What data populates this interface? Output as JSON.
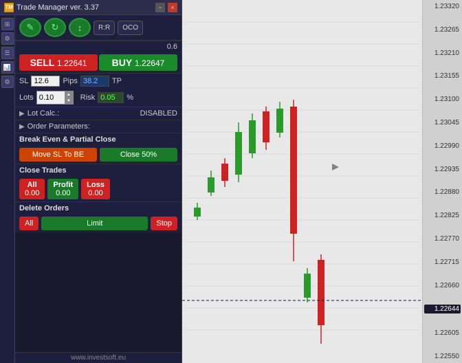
{
  "titleBar": {
    "title": "Trade Manager ver. 3.37",
    "minLabel": "−",
    "closeLabel": "×",
    "icon": "TM"
  },
  "toolbar": {
    "btn1": "✎",
    "btn2": "↻",
    "btn3": "↕",
    "rrLabel": "R:R",
    "ocoLabel": "OCO"
  },
  "lotDisplay": {
    "value": "0.6"
  },
  "tradeButtons": {
    "sellLabel": "SELL",
    "sellPrice": "1.22641",
    "buyLabel": "BUY",
    "buyPrice": "1.22647"
  },
  "slTp": {
    "slLabel": "SL",
    "slValue": "12.6",
    "pipsLabel": "Pips",
    "tpValue": "38.2",
    "tpLabel": "TP"
  },
  "lots": {
    "label": "Lots",
    "value": "0.10",
    "riskLabel": "Risk",
    "riskValue": "0.05",
    "percentLabel": "%"
  },
  "lotCalc": {
    "label": "Lot Calc.:",
    "value": "DISABLED"
  },
  "orderParams": {
    "label": "Order Parameters:"
  },
  "breakEven": {
    "title": "Break Even & Partial Close",
    "moveSlBtn": "Move SL To BE",
    "close50Btn": "Close 50%"
  },
  "closeTrades": {
    "title": "Close Trades",
    "allLabel": "All",
    "allValue": "0.00",
    "profitLabel": "Profit",
    "profitValue": "0.00",
    "lossLabel": "Loss",
    "lossValue": "0.00"
  },
  "deleteOrders": {
    "title": "Delete Orders",
    "allLabel": "All",
    "limitLabel": "Limit",
    "stopLabel": "Stop"
  },
  "footer": {
    "url": "www.investsoft.eu"
  },
  "priceScale": {
    "prices": [
      "1.23320",
      "1.23265",
      "1.23210",
      "1.23155",
      "1.23100",
      "1.23045",
      "1.22990",
      "1.22935",
      "1.22880",
      "1.22825",
      "1.22770",
      "1.22715",
      "1.22660",
      "1.22605",
      "1.22550"
    ],
    "currentPrice": "1.22644"
  }
}
